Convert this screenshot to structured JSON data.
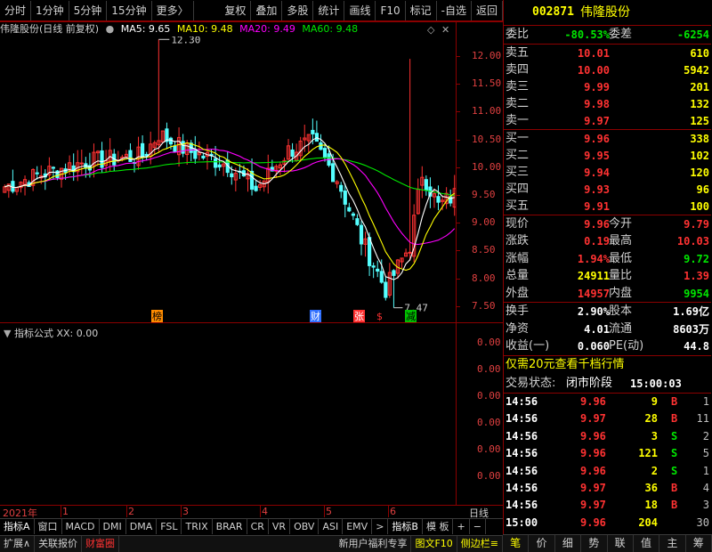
{
  "toolbar": {
    "items": [
      "分时",
      "1分钟",
      "5分钟",
      "15分钟",
      "更多〉"
    ],
    "right_items": [
      "复权",
      "叠加",
      "多股",
      "统计",
      "画线",
      "F10",
      "标记",
      "-自选",
      "返回"
    ]
  },
  "chart_header": {
    "title": "伟隆股份(日线 前复权)",
    "ma5": "MA5: 9.65",
    "ma10": "MA10: 9.48",
    "ma20": "MA20: 9.49",
    "ma60": "MA60: 9.48",
    "colors": {
      "ma5": "#ffffff",
      "ma10": "#ffff00",
      "ma20": "#ff00ff",
      "ma60": "#00e600"
    }
  },
  "price_axis": [
    "12.00",
    "11.50",
    "11.00",
    "10.50",
    "10.00",
    "9.50",
    "9.00",
    "8.50",
    "8.00",
    "7.50"
  ],
  "sub_axis": [
    "0.00",
    "0.00",
    "0.00",
    "0.00",
    "0.00",
    "0.00"
  ],
  "annotations": {
    "high": "12.30",
    "low": "7.47",
    "markers": [
      "榜",
      "财",
      "张",
      "$",
      "减"
    ]
  },
  "indicator": {
    "title": "指标公式 XX: 0.00"
  },
  "date_bar": {
    "year": "2021年",
    "months": [
      "1",
      "2",
      "3",
      "4",
      "5",
      "6"
    ],
    "period": "日线"
  },
  "tabs": [
    "指标A",
    "窗口",
    "MACD",
    "DMI",
    "DMA",
    "FSL",
    "TRIX",
    "BRAR",
    "CR",
    "VR",
    "OBV",
    "ASI",
    "EMV",
    ">",
    "指标B",
    "模 板",
    "+",
    "−"
  ],
  "status_bar": {
    "items": [
      "扩展∧",
      "关联报价",
      "财富圈"
    ],
    "right_items": [
      "新用户福利专享",
      "图文F10",
      "侧边栏≡"
    ]
  },
  "stock": {
    "code": "002871",
    "name": "伟隆股份"
  },
  "order_book": {
    "webi_label": "委比",
    "webi": "-80.53%",
    "weicha_label": "委差",
    "weicha": "-6254",
    "asks": [
      {
        "label": "卖五",
        "price": "10.01",
        "vol": "610"
      },
      {
        "label": "卖四",
        "price": "10.00",
        "vol": "5942"
      },
      {
        "label": "卖三",
        "price": "9.99",
        "vol": "201"
      },
      {
        "label": "卖二",
        "price": "9.98",
        "vol": "132"
      },
      {
        "label": "卖一",
        "price": "9.97",
        "vol": "125"
      }
    ],
    "bids": [
      {
        "label": "买一",
        "price": "9.96",
        "vol": "338"
      },
      {
        "label": "买二",
        "price": "9.95",
        "vol": "102"
      },
      {
        "label": "买三",
        "price": "9.94",
        "vol": "120"
      },
      {
        "label": "买四",
        "price": "9.93",
        "vol": "96"
      },
      {
        "label": "买五",
        "price": "9.91",
        "vol": "100"
      }
    ]
  },
  "quote": {
    "rows": [
      {
        "l1": "现价",
        "v1": "9.96",
        "c1": "red",
        "l2": "今开",
        "v2": "9.79",
        "c2": "red"
      },
      {
        "l1": "涨跌",
        "v1": "0.19",
        "c1": "red",
        "l2": "最高",
        "v2": "10.03",
        "c2": "red"
      },
      {
        "l1": "涨幅",
        "v1": "1.94%",
        "c1": "red",
        "l2": "最低",
        "v2": "9.72",
        "c2": "green"
      },
      {
        "l1": "总量",
        "v1": "24911",
        "c1": "yellow",
        "l2": "量比",
        "v2": "1.39",
        "c2": "red"
      },
      {
        "l1": "外盘",
        "v1": "14957",
        "c1": "red",
        "l2": "内盘",
        "v2": "9954",
        "c2": "green"
      }
    ],
    "rows2": [
      {
        "l1": "换手",
        "v1": "2.90%",
        "c1": "white",
        "l2": "股本",
        "v2": "1.69亿",
        "c2": "white"
      },
      {
        "l1": "净资",
        "v1": "4.01",
        "c1": "white",
        "l2": "流通",
        "v2": "8603万",
        "c2": "white"
      },
      {
        "l1": "收益(一)",
        "v1": "0.060",
        "c1": "white",
        "l2": "PE(动)",
        "v2": "44.8",
        "c2": "white"
      }
    ]
  },
  "promo": "仅需20元查看千档行情",
  "trade_status": {
    "label": "交易状态:",
    "value": "闭市阶段",
    "time": "15:00:03"
  },
  "ticks": [
    {
      "time": "14:56",
      "price": "9.96",
      "pc": "red",
      "vol": "9",
      "vc": "yellow",
      "bs": "B",
      "bsc": "red",
      "n": "1"
    },
    {
      "time": "14:56",
      "price": "9.97",
      "pc": "red",
      "vol": "28",
      "vc": "yellow",
      "bs": "B",
      "bsc": "red",
      "n": "11"
    },
    {
      "time": "14:56",
      "price": "9.96",
      "pc": "red",
      "vol": "3",
      "vc": "yellow",
      "bs": "S",
      "bsc": "green",
      "n": "2"
    },
    {
      "time": "14:56",
      "price": "9.96",
      "pc": "red",
      "vol": "121",
      "vc": "yellow",
      "bs": "S",
      "bsc": "green",
      "n": "5"
    },
    {
      "time": "14:56",
      "price": "9.96",
      "pc": "red",
      "vol": "2",
      "vc": "yellow",
      "bs": "S",
      "bsc": "green",
      "n": "1"
    },
    {
      "time": "14:56",
      "price": "9.97",
      "pc": "red",
      "vol": "36",
      "vc": "yellow",
      "bs": "B",
      "bsc": "red",
      "n": "4"
    },
    {
      "time": "14:56",
      "price": "9.97",
      "pc": "red",
      "vol": "18",
      "vc": "yellow",
      "bs": "B",
      "bsc": "red",
      "n": "3"
    },
    {
      "time": "15:00",
      "price": "9.96",
      "pc": "red",
      "vol": "204",
      "vc": "yellow",
      "bs": "",
      "bsc": "red",
      "n": "30"
    }
  ],
  "right_tabs": [
    "笔",
    "价",
    "细",
    "势",
    "联",
    "值",
    "主",
    "筹"
  ]
}
